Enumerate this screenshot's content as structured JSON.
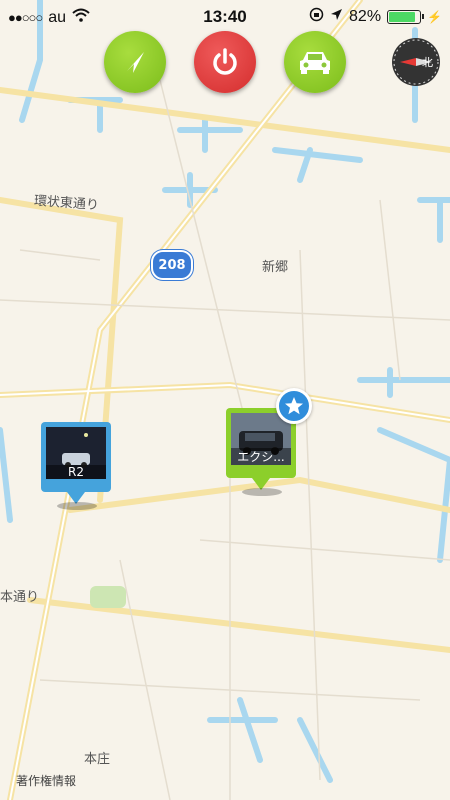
{
  "status_bar": {
    "carrier": "au",
    "time": "13:40",
    "battery_percent": "82%",
    "battery_level": 0.82
  },
  "buttons": {
    "navigate_icon": "arrow-icon",
    "power_icon": "power-icon",
    "car_icon": "car-icon"
  },
  "map": {
    "labels": {
      "street_1": "環状東通り",
      "area_1": "新郷",
      "street_2": "本通り",
      "area_2": "本庄"
    },
    "route_number": "208",
    "legal": "著作権情報"
  },
  "pins": {
    "pin_1": {
      "caption": "R2"
    },
    "pin_2": {
      "caption": "エクシ..."
    }
  },
  "colors": {
    "green": "#8cc83b",
    "red": "#d42d2d",
    "water": "#a9d7ef",
    "road": "#f6e3a4",
    "pin_blue": "#45a3dc",
    "pin_green": "#8ccf2b"
  }
}
